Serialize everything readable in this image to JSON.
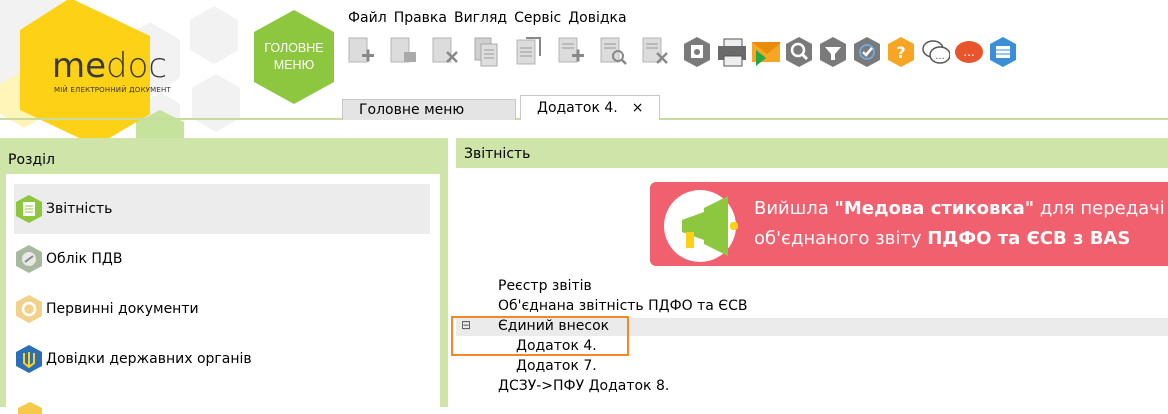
{
  "logo": {
    "name_left": "me",
    "name_right": "doc",
    "tagline": "МІЙ ЕЛЕКТРОННИЙ ДОКУМЕНТ"
  },
  "main_menu_hex": {
    "line1": "ГОЛОВНЕ",
    "line2": "МЕНЮ"
  },
  "menu": [
    "Файл",
    "Правка",
    "Вигляд",
    "Сервіс",
    "Довідка"
  ],
  "toolbar_icons": [
    "new-doc-icon",
    "open-doc-icon",
    "delete-doc-icon",
    "copy-doc-icon",
    "edit-doc-icon",
    "add-doc-icon",
    "search-doc-icon",
    "remove-doc-icon",
    "settings-icon",
    "print-icon",
    "send-icon",
    "find-icon",
    "filter-icon",
    "verify-icon",
    "help-icon",
    "chat-icon",
    "feedback-icon",
    "video-icon"
  ],
  "tabs": [
    {
      "label": "Головне меню"
    },
    {
      "label": "Додаток 4.",
      "close": "×"
    }
  ],
  "left": {
    "title": "Розділ",
    "items": [
      {
        "label": "Звітність",
        "icon": "report-icon"
      },
      {
        "label": "Облік ПДВ",
        "icon": "vat-icon"
      },
      {
        "label": "Первинні документи",
        "icon": "primary-docs-icon"
      },
      {
        "label": "Довідки державних органів",
        "icon": "trident-icon"
      }
    ]
  },
  "right": {
    "title": "Звітність",
    "banner": {
      "line1_pre": "Вийшла ",
      "line1_bold": "\"Медова стиковка\"",
      "line1_post": " для передачі",
      "line2_pre": "об'єднаного звіту ",
      "line2_bold": "ПДФО та ЄСВ з BAS"
    },
    "tree": {
      "item1": "Реєстр звітів",
      "item2": "Об'єднана звітність ПДФО та ЄСВ",
      "item3_toggle": "⊟",
      "item3": "Єдиний внесок",
      "item3_1": "Додаток 4.",
      "item3_2": "Додаток 7.",
      "item4": "ДСЗУ->ПФУ Додаток 8."
    }
  },
  "colors": {
    "accent_green": "#8dc63f",
    "panel_green": "#cfe4a8",
    "banner_red": "#f0606e",
    "logo_yellow": "#fcd116",
    "highlight_orange": "#f08a24"
  }
}
